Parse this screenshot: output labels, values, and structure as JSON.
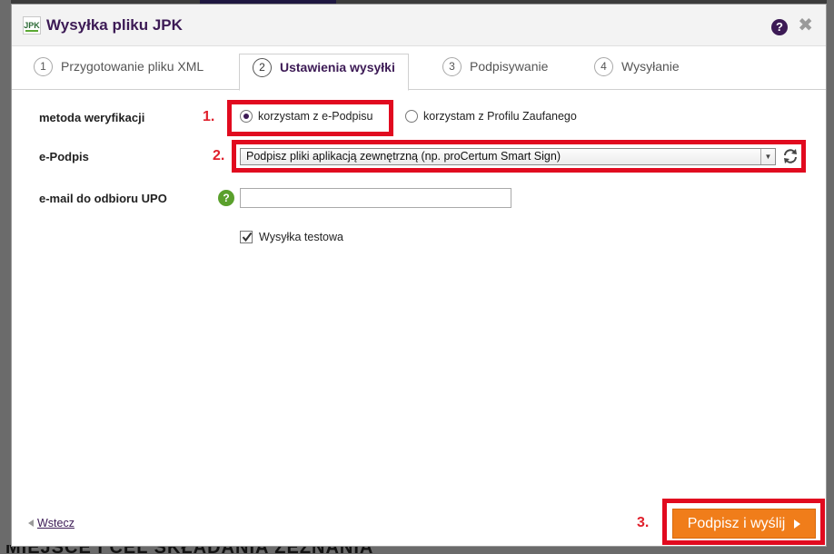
{
  "dialog": {
    "logo_text": "JPK",
    "title": "Wysyłka pliku JPK",
    "help_icon": "question-icon",
    "close_icon": "close-icon",
    "close_glyph": "✖",
    "help_glyph": "?"
  },
  "tabs": [
    {
      "num": "1",
      "label": "Przygotowanie pliku XML",
      "active": false
    },
    {
      "num": "2",
      "label": "Ustawienia wysyłki",
      "active": true
    },
    {
      "num": "3",
      "label": "Podpisywanie",
      "active": false
    },
    {
      "num": "4",
      "label": "Wysyłanie",
      "active": false
    }
  ],
  "form": {
    "verification": {
      "label": "metoda weryfikacji",
      "step": "1.",
      "options": [
        {
          "label": "korzystam z e-Podpisu",
          "selected": true
        },
        {
          "label": "korzystam z Profilu Zaufanego",
          "selected": false
        }
      ]
    },
    "esignature": {
      "label": "e-Podpis",
      "step": "2.",
      "selected_value": "Podpisz pliki aplikacją zewnętrzną (np. proCertum Smart Sign)",
      "refresh_icon": "refresh-icon"
    },
    "email": {
      "label": "e-mail do odbioru UPO",
      "help_glyph": "?",
      "value": "",
      "placeholder": ""
    },
    "test_send": {
      "label": "Wysyłka testowa",
      "checked": true
    }
  },
  "footer": {
    "back_label": "Wstecz",
    "step": "3.",
    "primary_label": "Podpisz i wyślij"
  },
  "colors": {
    "accent": "#3c1a55",
    "primary_button": "#f07d1a",
    "highlight": "#e10a1f",
    "help_green": "#5aa02c"
  },
  "background": {
    "bottom_text": "MIEJSCE I CEL SKŁADANIA ZEZNANIA"
  }
}
